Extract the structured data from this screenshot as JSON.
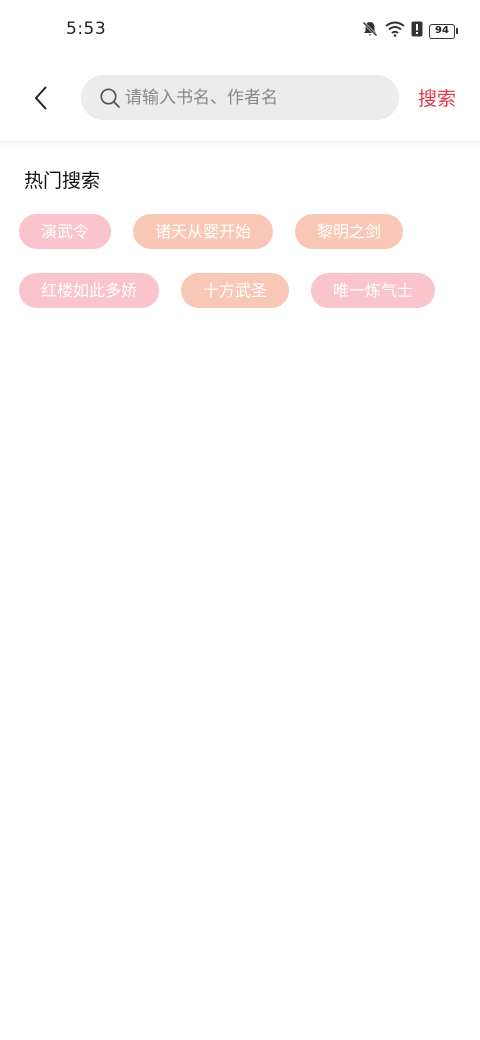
{
  "status_bar": {
    "time": "5:53",
    "battery": "94",
    "icons": [
      "bell-off-icon",
      "wifi-icon",
      "alert-icon",
      "battery-icon"
    ]
  },
  "header": {
    "back_icon": "chevron-left-icon",
    "search_placeholder": "请输入书名、作者名",
    "search_value": "",
    "search_button": "搜索",
    "accent_color": "#e4394b"
  },
  "hot_search": {
    "title": "热门搜索",
    "tags": [
      {
        "label": "演武令",
        "color": "#f9c4cc"
      },
      {
        "label": "诸天从婴开始",
        "color": "#f9c7b6"
      },
      {
        "label": "黎明之剑",
        "color": "#f9c7b6"
      },
      {
        "label": "红楼如此多娇",
        "color": "#f9c4cc"
      },
      {
        "label": "十方武圣",
        "color": "#f9c7b6"
      },
      {
        "label": "唯一炼气士",
        "color": "#f9c4cc"
      }
    ]
  }
}
